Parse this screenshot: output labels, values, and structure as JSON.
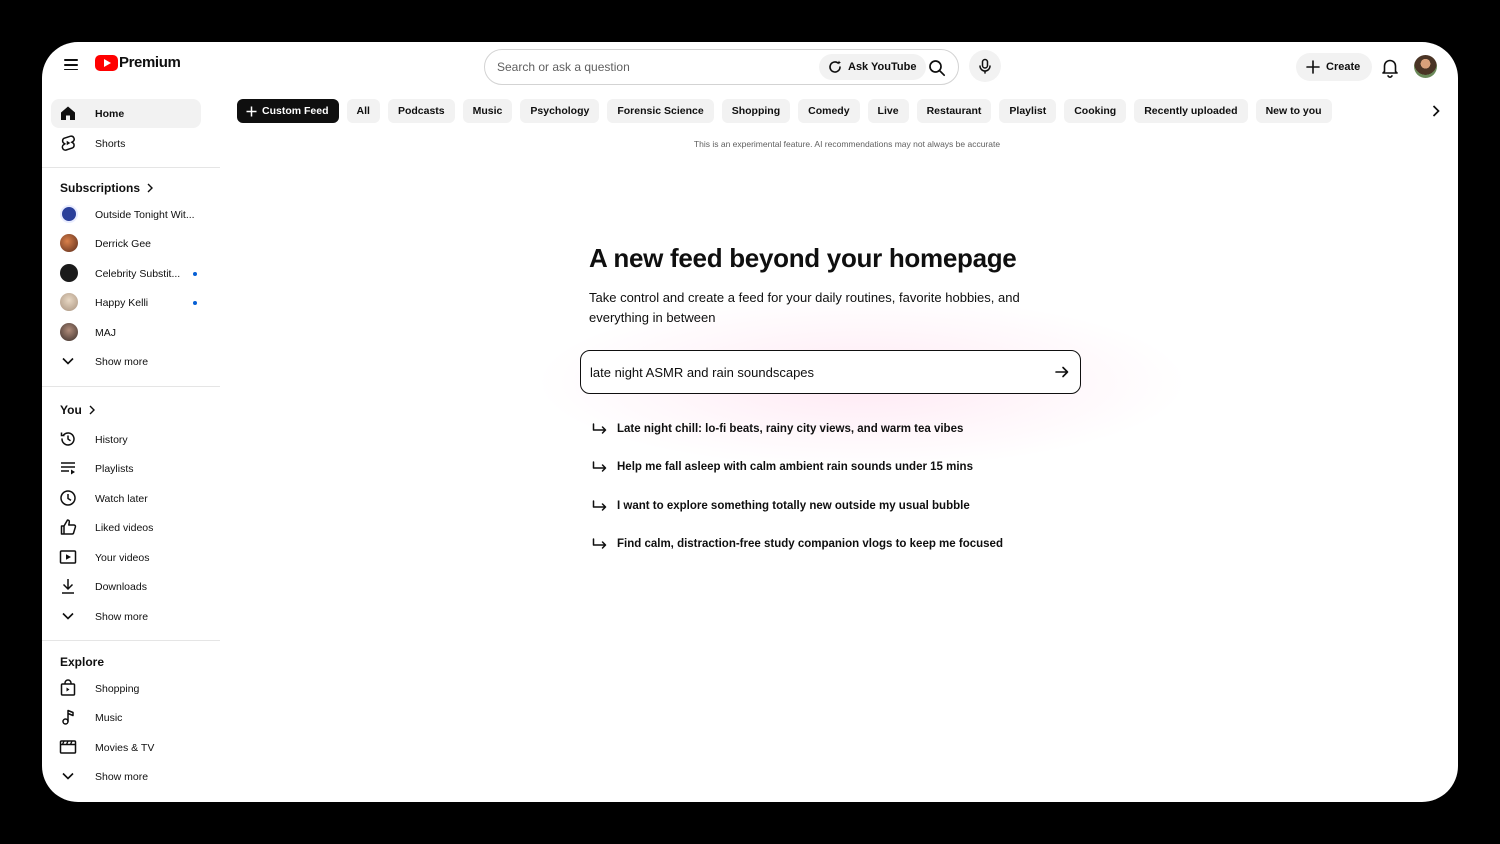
{
  "header": {
    "logo_text": "Premium",
    "search_placeholder": "Search or ask a question",
    "ask_label": "Ask YouTube",
    "create_label": "Create"
  },
  "sidebar": {
    "main": [
      {
        "label": "Home",
        "icon": "home-icon",
        "active": true
      },
      {
        "label": "Shorts",
        "icon": "shorts-icon"
      }
    ],
    "subscriptions_title": "Subscriptions",
    "subscriptions": [
      {
        "label": "Outside Tonight Wit...",
        "color": "#2a3f9a",
        "dot": false
      },
      {
        "label": "Derrick Gee",
        "color": "#8a4a2e",
        "dot": false
      },
      {
        "label": "Celebrity Substit...",
        "color": "#1a1a1a",
        "dot": true
      },
      {
        "label": "Happy Kelli",
        "color": "#c9b8a6",
        "dot": true
      },
      {
        "label": "MAJ",
        "color": "#5a4a44",
        "dot": false
      }
    ],
    "subscriptions_more": "Show more",
    "you_title": "You",
    "you": [
      {
        "label": "History",
        "icon": "history-icon"
      },
      {
        "label": "Playlists",
        "icon": "playlists-icon"
      },
      {
        "label": "Watch later",
        "icon": "clock-icon"
      },
      {
        "label": "Liked videos",
        "icon": "thumbs-up-icon"
      },
      {
        "label": "Your videos",
        "icon": "play-box-icon"
      },
      {
        "label": "Downloads",
        "icon": "download-icon"
      }
    ],
    "you_more": "Show more",
    "explore_title": "Explore",
    "explore": [
      {
        "label": "Shopping",
        "icon": "shopping-bag-icon"
      },
      {
        "label": "Music",
        "icon": "music-note-icon"
      },
      {
        "label": "Movies & TV",
        "icon": "clapperboard-icon"
      }
    ],
    "explore_more": "Show more"
  },
  "chips": {
    "custom_feed": "Custom Feed",
    "items": [
      "All",
      "Podcasts",
      "Music",
      "Psychology",
      "Forensic Science",
      "Shopping",
      "Comedy",
      "Live",
      "Restaurant",
      "Playlist",
      "Cooking",
      "Recently uploaded",
      "New to you"
    ]
  },
  "disclaimer": "This is an experimental feature. AI recommendations may not always be accurate",
  "main": {
    "headline": "A new feed beyond your homepage",
    "subhead": "Take control and create a feed for your daily routines, favorite hobbies, and everything in between",
    "prompt_value": "late night ASMR and rain soundscapes",
    "suggestions": [
      "Late night chill: lo-fi beats, rainy city views, and warm tea vibes",
      "Help me fall asleep with calm ambient rain sounds under 15 mins",
      "I want to explore something totally new outside my usual bubble",
      "Find calm, distraction-free study companion vlogs to keep me focused"
    ]
  }
}
